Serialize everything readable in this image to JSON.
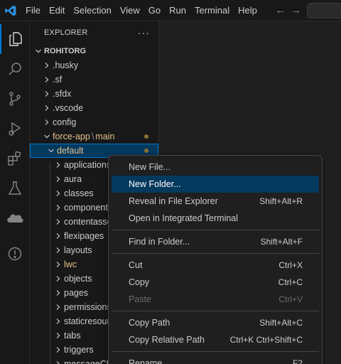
{
  "titlebar": {
    "menu": [
      "File",
      "Edit",
      "Selection",
      "View",
      "Go",
      "Run",
      "Terminal",
      "Help"
    ],
    "back_icon": "arrow-left-icon",
    "forward_icon": "arrow-right-icon"
  },
  "activitybar": {
    "items": [
      "explorer-icon",
      "search-icon",
      "source-control-icon",
      "run-debug-icon",
      "extensions-icon",
      "testing-icon",
      "salesforce-icon",
      "problems-icon"
    ]
  },
  "explorer": {
    "title": "EXPLORER",
    "more": "···",
    "root": "ROHITORG",
    "folders": [
      ".husky",
      ".sf",
      ".sfdx",
      ".vscode",
      "config"
    ],
    "force_app": {
      "part1": "force-app",
      "sep": "\\",
      "part2": "main"
    },
    "default": "default",
    "children": [
      "applications",
      "aura",
      "classes",
      "components",
      "contentassets",
      "flexipages",
      "layouts",
      "lwc",
      "objects",
      "pages",
      "permissionsets",
      "staticresources",
      "tabs",
      "triggers"
    ],
    "last_partial": "messageChannels",
    "accent_color": "#e2c08d",
    "selection_color": "#04395e"
  },
  "context_menu": {
    "new_file": "New File...",
    "new_folder": "New Folder...",
    "reveal": "Reveal in File Explorer",
    "reveal_kb": "Shift+Alt+R",
    "open_terminal": "Open in Integrated Terminal",
    "find_in_folder": "Find in Folder...",
    "find_in_folder_kb": "Shift+Alt+F",
    "cut": "Cut",
    "cut_kb": "Ctrl+X",
    "copy": "Copy",
    "copy_kb": "Ctrl+C",
    "paste": "Paste",
    "paste_kb": "Ctrl+V",
    "copy_path": "Copy Path",
    "copy_path_kb": "Shift+Alt+C",
    "copy_relative_path": "Copy Relative Path",
    "copy_relative_path_kb": "Ctrl+K Ctrl+Shift+C",
    "rename": "Rename",
    "rename_kb": "F2"
  }
}
